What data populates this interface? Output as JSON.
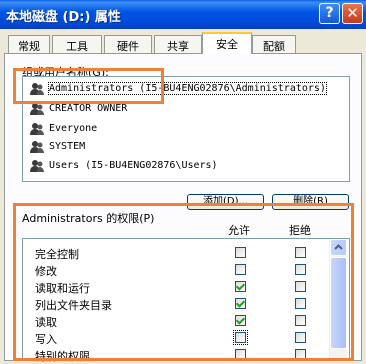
{
  "window": {
    "title": "本地磁盘 (D:) 属性",
    "help_label": "?",
    "close_label": "✕"
  },
  "tabs": [
    "常规",
    "工具",
    "硬件",
    "共享",
    "安全",
    "配额"
  ],
  "active_tab": "安全",
  "groups": {
    "label": "组或用户名称(G):",
    "items": [
      "Administrators (I5-BU4ENG02876\\Administrators)",
      "CREATOR OWNER",
      "Everyone",
      "SYSTEM",
      "Users (I5-BU4ENG02876\\Users)"
    ],
    "selected_index": 0
  },
  "buttons": {
    "add": "添加(D)...",
    "remove": "删除(R)"
  },
  "permissions": {
    "label": "Administrators 的权限(P)",
    "allow_header": "允许",
    "deny_header": "拒绝",
    "rows": [
      {
        "name": "完全控制",
        "allow": false,
        "deny": false
      },
      {
        "name": "修改",
        "allow": false,
        "deny": false
      },
      {
        "name": "读取和运行",
        "allow": true,
        "deny": false
      },
      {
        "name": "列出文件夹目录",
        "allow": true,
        "deny": false
      },
      {
        "name": "读取",
        "allow": true,
        "deny": false
      },
      {
        "name": "写入",
        "allow": false,
        "deny": false
      },
      {
        "name": "特别的权限",
        "allow": false,
        "deny": false
      }
    ]
  },
  "colors": {
    "highlight_box": "#ef7f39",
    "check": "#21a121",
    "title_bar": "#0055e5"
  }
}
